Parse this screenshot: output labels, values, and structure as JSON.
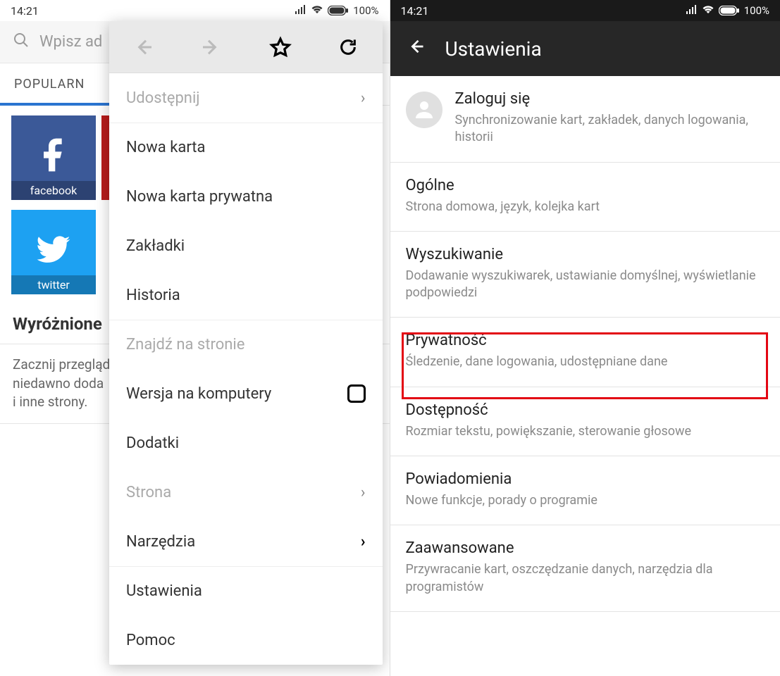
{
  "status": {
    "time": "14:21",
    "battery": "100%"
  },
  "left": {
    "search_placeholder": "Wpisz ad",
    "tab_popular": "POPULARN",
    "tiles": {
      "facebook": "facebook",
      "twitter": "twitter"
    },
    "section_title": "Wyróżnione",
    "desc": "Zacznij przegląd\nniedawno doda\ni inne strony."
  },
  "dropdown": {
    "share": "Udostępnij",
    "new_tab": "Nowa karta",
    "new_private": "Nowa karta prywatna",
    "bookmarks": "Zakładki",
    "history": "Historia",
    "find": "Znajdź na stronie",
    "desktop": "Wersja na komputery",
    "addons": "Dodatki",
    "page": "Strona",
    "tools": "Narzędzia",
    "settings": "Ustawienia",
    "help": "Pomoc"
  },
  "right": {
    "header_title": "Ustawienia",
    "items": [
      {
        "title": "Zaloguj się",
        "sub": "Synchronizowanie kart, zakładek, danych logowania, historii"
      },
      {
        "title": "Ogólne",
        "sub": "Strona domowa, język, kolejka kart"
      },
      {
        "title": "Wyszukiwanie",
        "sub": "Dodawanie wyszukiwarek, ustawianie domyślnej, wyświetlanie podpowiedzi"
      },
      {
        "title": "Prywatność",
        "sub": "Śledzenie, dane logowania, udostępniane dane"
      },
      {
        "title": "Dostępność",
        "sub": "Rozmiar tekstu, powiększanie, sterowanie głosowe"
      },
      {
        "title": "Powiadomienia",
        "sub": "Nowe funkcje, porady o programie"
      },
      {
        "title": "Zaawansowane",
        "sub": "Przywracanie kart, oszczędzanie danych, narzędzia dla programistów"
      }
    ]
  }
}
